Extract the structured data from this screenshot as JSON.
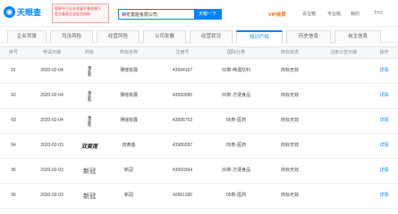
{
  "header": {
    "logo_text": "天眼查",
    "promo_lines": [
      "国家中小企业发展子基金旗下",
      "官方备案企业征信机构"
    ],
    "search_value": "钟宏富能有限公司",
    "search_button": "天眼一下",
    "vip_label": "VIP会员",
    "nav": [
      "百宝箱",
      "专业版",
      "我的",
      "TYC"
    ]
  },
  "tabs": [
    {
      "label": "企业背景",
      "active": false
    },
    {
      "label": "司法风险",
      "active": false
    },
    {
      "label": "经营风险",
      "active": false
    },
    {
      "label": "公司发展",
      "active": false
    },
    {
      "label": "经营状况",
      "active": false
    },
    {
      "label": "知识产权",
      "active": true
    },
    {
      "label": "历史信息",
      "active": false
    },
    {
      "label": "自主信息",
      "active": false
    }
  ],
  "table": {
    "headers": [
      "序号",
      "申请日期",
      "商标",
      "商标名称",
      "注册号",
      "国际分类",
      "商标状态",
      "注册公告日期",
      "操作"
    ],
    "rows": [
      {
        "no": "91",
        "date": "2020-02-04",
        "mark_style": "vertical",
        "mark_text": "薄底鸭",
        "name": "薄瑶有展",
        "reg": "43994167",
        "class": "32类-啤酒饮料",
        "status": "商标无效",
        "detail": "详情"
      },
      {
        "no": "92",
        "date": "2020-02-04",
        "mark_style": "vertical",
        "mark_text": "薄底鸭",
        "name": "薄瑶有展",
        "reg": "43993086",
        "class": "30类-方便食品",
        "status": "商标无效",
        "detail": "详情"
      },
      {
        "no": "93",
        "date": "2020-02-04",
        "mark_style": "vertical",
        "mark_text": "薄底鸭",
        "name": "薄瑶有展",
        "reg": "43995753",
        "class": "05类-医药",
        "status": "商标无效",
        "detail": "详情"
      },
      {
        "no": "94",
        "date": "2020-02-03",
        "mark_style": "script",
        "mark_text": "双黄莲",
        "name": "双黄莲",
        "reg": "43989287",
        "class": "05类-医药",
        "status": "商标无效",
        "detail": "详情"
      },
      {
        "no": "95",
        "date": "2020-02-03",
        "mark_style": "serif",
        "mark_text": "新冠",
        "name": "新冠",
        "reg": "43993364",
        "class": "30类-方便食品",
        "status": "商标无效",
        "detail": "详情"
      },
      {
        "no": "96",
        "date": "2020-02-03",
        "mark_style": "serif",
        "mark_text": "新冠",
        "name": "新冠",
        "reg": "43961180",
        "class": "05类-医药",
        "status": "商标无效",
        "detail": "详情"
      }
    ]
  },
  "colors": {
    "accent": "#0084ff",
    "vip": "#ff6b00"
  }
}
